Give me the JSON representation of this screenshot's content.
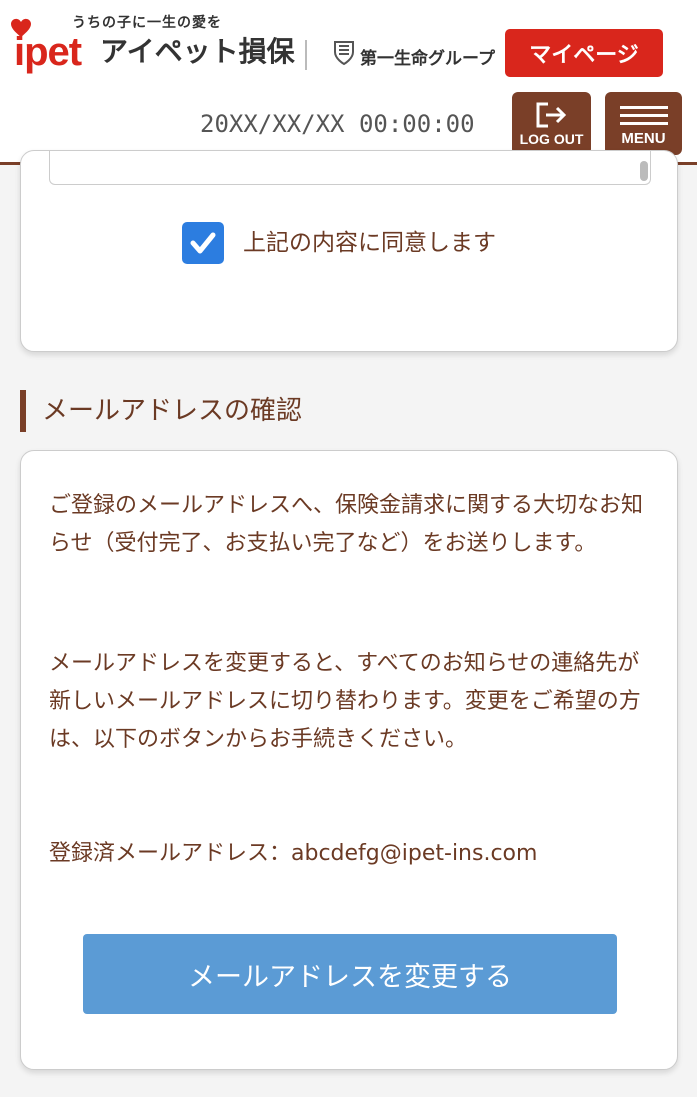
{
  "header": {
    "tagline": "うちの子に一生の愛を",
    "logo_brand": "ipet",
    "logo_name": "アイペット損保",
    "group_name": "第一生命グループ",
    "mypage_label": "マイページ",
    "datetime": "20XX/XX/XX 00:00:00",
    "logout_label": "LOG OUT",
    "menu_label": "MENU"
  },
  "agreement": {
    "checked": true,
    "label": "上記の内容に同意します"
  },
  "email_section": {
    "heading": "メールアドレスの確認",
    "paragraph1": "ご登録のメールアドレスへ、保険金請求に関する大切なお知らせ（受付完了、お支払い完了など）をお送りします。",
    "paragraph2": "メールアドレスを変更すると、すべてのお知らせの連絡先が新しいメールアドレスに切り替わります。変更をご希望の方は、以下のボタンからお手続きください。",
    "registered_label": "登録済メールアドレス：",
    "registered_email": "abcdefg@ipet-ins.com",
    "change_button": "メールアドレスを変更する"
  },
  "colors": {
    "brand_red": "#d9261c",
    "brown": "#7a3f28",
    "text_brown": "#6b3a24",
    "button_blue": "#5b9bd5",
    "check_blue": "#2c7de0"
  },
  "icons": {
    "logout": "logout-arrow-icon",
    "menu": "hamburger-icon",
    "check": "checkmark-icon",
    "heart": "heart-icon",
    "group_mark": "dai-ichi-shield-icon"
  }
}
